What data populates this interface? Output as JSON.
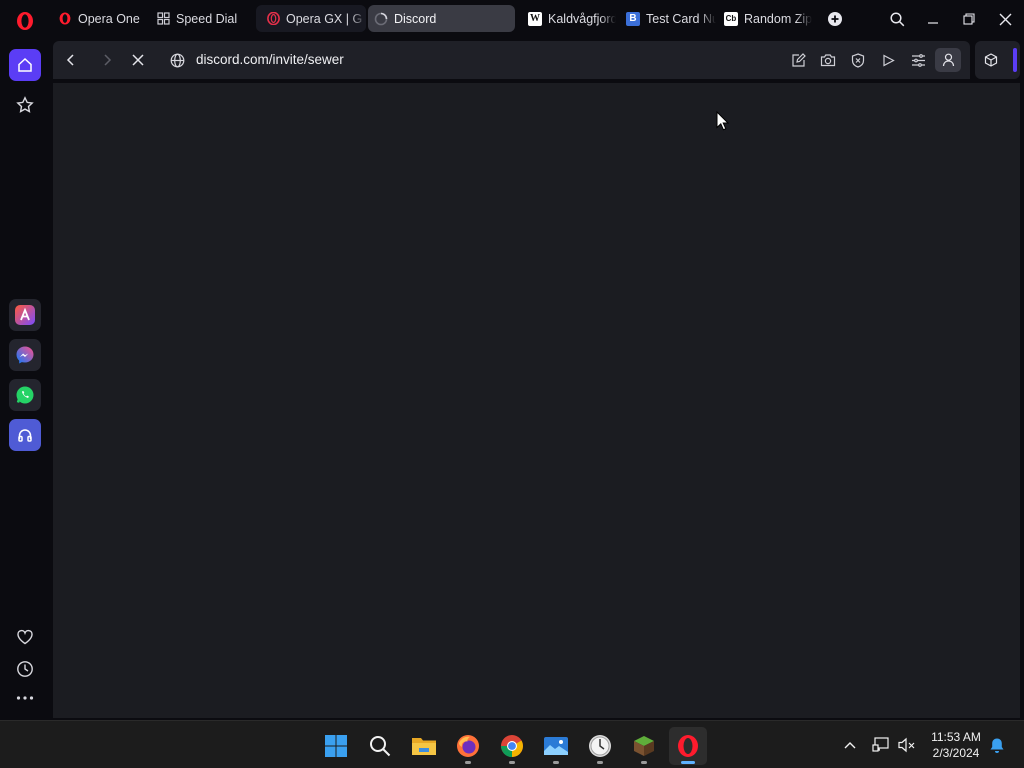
{
  "browser": {
    "tabs": [
      {
        "title": "Opera One",
        "icon": "opera-icon"
      },
      {
        "title": "Speed Dial",
        "icon": "grid-icon"
      },
      {
        "title": "Opera GX | G",
        "icon": "opera-gx-icon",
        "island": true
      },
      {
        "title": "Discord",
        "icon": "loading-spinner-icon",
        "active": true,
        "island": true
      },
      {
        "title": "Kaldvågfjord",
        "icon": "wikipedia-icon"
      },
      {
        "title": "Test Card Nu",
        "icon": "b-icon"
      },
      {
        "title": "Random Zip",
        "icon": "cb-icon"
      }
    ],
    "address": {
      "url": "discord.com/invite/sewer"
    },
    "accent_color": "#5b3df5"
  },
  "taskbar": {
    "clock": {
      "time": "11:53 AM",
      "date": "2/3/2024"
    },
    "apps": [
      "windows-start-icon",
      "search-icon",
      "file-explorer-icon",
      "firefox-icon",
      "chrome-icon",
      "photos-icon",
      "clock-app-icon",
      "minecraft-icon",
      "opera-icon"
    ]
  }
}
